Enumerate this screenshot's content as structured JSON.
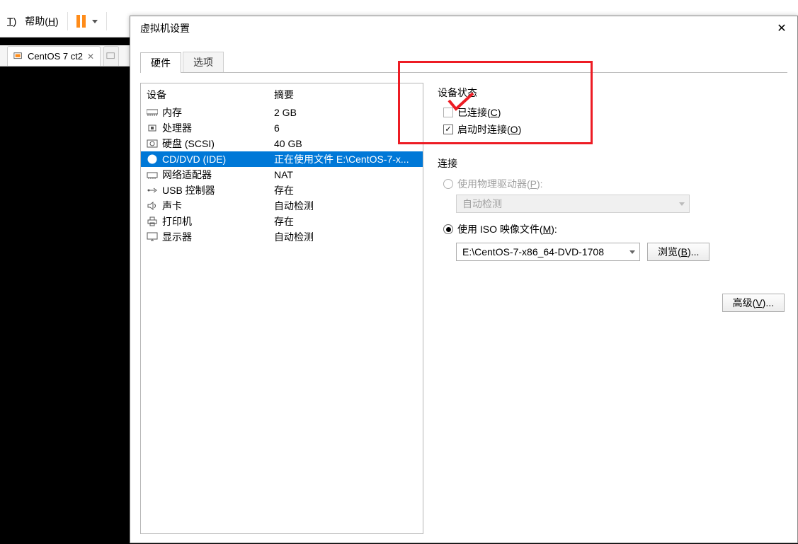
{
  "app": {
    "menu_t_suffix": ")",
    "menu_t_letter": "T",
    "help_label_prefix": "帮助(",
    "help_letter": "H",
    "help_suffix": ")"
  },
  "tabs": {
    "main_tab": "CentOS 7 ct2"
  },
  "dialog": {
    "title": "虚拟机设置",
    "tab_hardware": "硬件",
    "tab_options": "选项"
  },
  "dev_header": {
    "device": "设备",
    "summary": "摘要"
  },
  "devices": [
    {
      "name": "内存",
      "summary": "2 GB",
      "icon": "mem"
    },
    {
      "name": "处理器",
      "summary": "6",
      "icon": "cpu"
    },
    {
      "name": "硬盘 (SCSI)",
      "summary": "40 GB",
      "icon": "hdd"
    },
    {
      "name": "CD/DVD (IDE)",
      "summary": "正在使用文件 E:\\CentOS-7-x...",
      "icon": "cd",
      "selected": true
    },
    {
      "name": "网络适配器",
      "summary": "NAT",
      "icon": "net"
    },
    {
      "name": "USB 控制器",
      "summary": "存在",
      "icon": "usb"
    },
    {
      "name": "声卡",
      "summary": "自动检测",
      "icon": "snd"
    },
    {
      "name": "打印机",
      "summary": "存在",
      "icon": "prn"
    },
    {
      "name": "显示器",
      "summary": "自动检测",
      "icon": "disp"
    }
  ],
  "state": {
    "group": "设备状态",
    "connected_pre": "已连接(",
    "connected_letter": "C",
    "connected_suf": ")",
    "poweron_pre": "启动时连接(",
    "poweron_letter": "O",
    "poweron_suf": ")"
  },
  "conn": {
    "group": "连接",
    "phys_pre": "使用物理驱动器(",
    "phys_letter": "P",
    "phys_suf": "):",
    "auto_detect": "自动检测",
    "iso_pre": "使用 ISO 映像文件(",
    "iso_letter": "M",
    "iso_suf": "):",
    "iso_path": "E:\\CentOS-7-x86_64-DVD-1708",
    "browse_pre": "浏览(",
    "browse_letter": "B",
    "browse_suf": ")..."
  },
  "advanced_pre": "高级(",
  "advanced_letter": "V",
  "advanced_suf": ")..."
}
